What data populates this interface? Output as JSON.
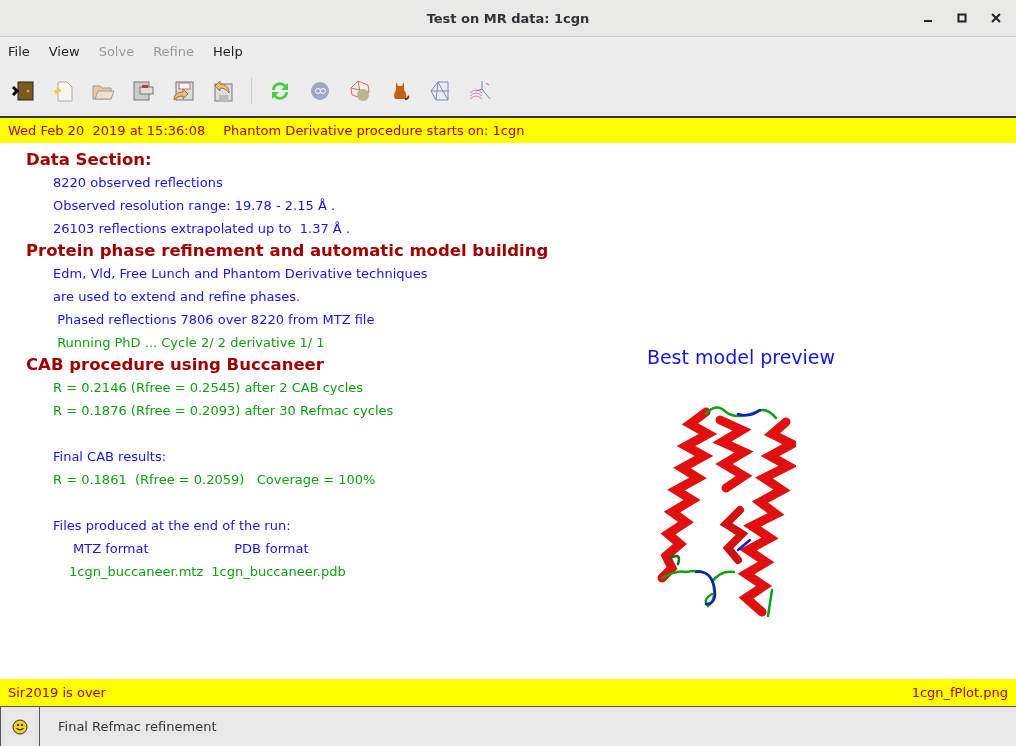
{
  "window": {
    "title": "Test on MR data: 1cgn"
  },
  "menu": [
    {
      "label": "File",
      "disabled": false
    },
    {
      "label": "View",
      "disabled": false
    },
    {
      "label": "Solve",
      "disabled": true
    },
    {
      "label": "Refine",
      "disabled": true
    },
    {
      "label": "Help",
      "disabled": false
    }
  ],
  "top_banner": {
    "timestamp": "Wed Feb 20  2019 at 15:36:08",
    "message": "Phantom Derivative procedure starts on: 1cgn"
  },
  "log": [
    {
      "kind": "heading",
      "text": "Data Section:"
    },
    {
      "kind": "info",
      "text": "8220 observed reflections"
    },
    {
      "kind": "info",
      "text": "Observed resolution range: 19.78 - 2.15 Å ."
    },
    {
      "kind": "info",
      "text": "26103 reflections extrapolated up to  1.37 Å ."
    },
    {
      "kind": "heading",
      "text": "Protein phase refinement and automatic model building"
    },
    {
      "kind": "info",
      "text": "Edm, Vld, Free Lunch and Phantom Derivative techniques"
    },
    {
      "kind": "info",
      "text": "are used to extend and refine phases."
    },
    {
      "kind": "info",
      "text": " Phased reflections 7806 over 8220 from MTZ file"
    },
    {
      "kind": "result",
      "text": " Running PhD ... Cycle 2/ 2 derivative 1/ 1"
    },
    {
      "kind": "heading",
      "text": "CAB procedure using Buccaneer"
    },
    {
      "kind": "result",
      "text": "R = 0.2146 (Rfree = 0.2545) after 2 CAB cycles"
    },
    {
      "kind": "result",
      "text": "R = 0.1876 (Rfree = 0.2093) after 30 Refmac cycles"
    },
    {
      "kind": "info",
      "text": "Final CAB results:",
      "gap_before": true
    },
    {
      "kind": "result",
      "text": "R = 0.1861  (Rfree = 0.2059)   Coverage = 100%"
    },
    {
      "kind": "info",
      "text": "Files produced at the end of the run:",
      "gap_before": true
    }
  ],
  "files": [
    {
      "format": "MTZ format",
      "name": "1cgn_buccaneer.mtz"
    },
    {
      "format": "PDB format",
      "name": "1cgn_buccaneer.pdb"
    }
  ],
  "preview": {
    "title": "Best model preview"
  },
  "bottom_banner": {
    "left": "Sir2019 is over",
    "right": "1cgn_fPlot.png"
  },
  "status_bar": {
    "text": "Final Refmac refinement"
  }
}
